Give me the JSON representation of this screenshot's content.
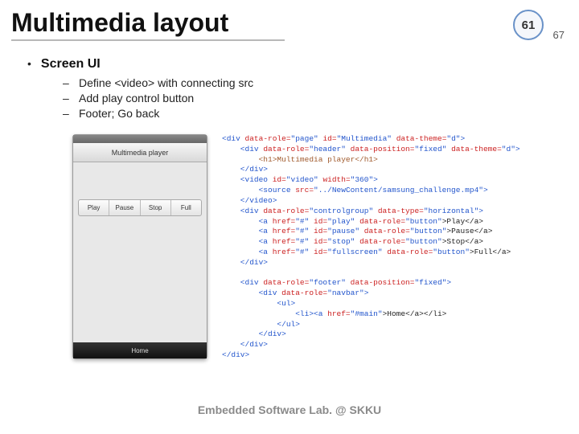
{
  "header": {
    "title": "Multimedia layout",
    "page_current": "61",
    "page_total": "67"
  },
  "bullet": {
    "heading": "Screen UI",
    "items": [
      "Define <video> with connecting src",
      "Add play control button",
      "Footer; Go back"
    ]
  },
  "phone": {
    "header": "Multimedia player",
    "buttons": [
      "Play",
      "Pause",
      "Stop",
      "Full"
    ],
    "footer": "Home"
  },
  "code": {
    "l1a": "<div ",
    "l1b": "data-role=",
    "l1c": "\"page\" ",
    "l1d": "id=",
    "l1e": "\"Multimedia\" ",
    "l1f": "data-theme=",
    "l1g": "\"d\"",
    "l1h": ">",
    "l2a": "    <div ",
    "l2b": "data-role=",
    "l2c": "\"header\" ",
    "l2d": "data-position=",
    "l2e": "\"fixed\" ",
    "l2f": "data-theme=",
    "l2g": "\"d\"",
    "l2h": ">",
    "l3": "        <h1>Multimedia player</h1>",
    "l4": "    </div>",
    "l5a": "    <video ",
    "l5b": "id=",
    "l5c": "\"video\" ",
    "l5d": "width=",
    "l5e": "\"360\"",
    "l5f": ">",
    "l6a": "        <source ",
    "l6b": "src=",
    "l6c": "\"../NewContent/samsung_challenge.mp4\"",
    "l6d": ">",
    "l7": "    </video>",
    "l8a": "    <div ",
    "l8b": "data-role=",
    "l8c": "\"controlgroup\" ",
    "l8d": "data-type=",
    "l8e": "\"horizontal\"",
    "l8f": ">",
    "l9a": "        <a ",
    "l9b": "href=",
    "l9c": "\"#\" ",
    "l9d": "id=",
    "l9e": "\"play\" ",
    "l9f": "data-role=",
    "l9g": "\"button\"",
    "l9h": ">Play</a>",
    "l10a": "        <a ",
    "l10b": "href=",
    "l10c": "\"#\" ",
    "l10d": "id=",
    "l10e": "\"pause\" ",
    "l10f": "data-role=",
    "l10g": "\"button\"",
    "l10h": ">Pause</a>",
    "l11a": "        <a ",
    "l11b": "href=",
    "l11c": "\"#\" ",
    "l11d": "id=",
    "l11e": "\"stop\" ",
    "l11f": "data-role=",
    "l11g": "\"button\"",
    "l11h": ">Stop</a>",
    "l12a": "        <a ",
    "l12b": "href=",
    "l12c": "\"#\" ",
    "l12d": "id=",
    "l12e": "\"fullscreen\" ",
    "l12f": "data-role=",
    "l12g": "\"button\"",
    "l12h": ">Full</a>",
    "l13": "    </div>",
    "blank1": "",
    "l14a": "    <div ",
    "l14b": "data-role=",
    "l14c": "\"footer\" ",
    "l14d": "data-position=",
    "l14e": "\"fixed\"",
    "l14f": ">",
    "l15a": "        <div ",
    "l15b": "data-role=",
    "l15c": "\"navbar\"",
    "l15d": ">",
    "l16": "            <ul>",
    "l17a": "                <li><a ",
    "l17b": "href=",
    "l17c": "\"#main\"",
    "l17d": ">Home</a></li>",
    "l18": "            </ul>",
    "l19": "        </div>",
    "l20": "    </div>",
    "l21": "</div>"
  },
  "footer_lab": "Embedded Software Lab. @ SKKU"
}
